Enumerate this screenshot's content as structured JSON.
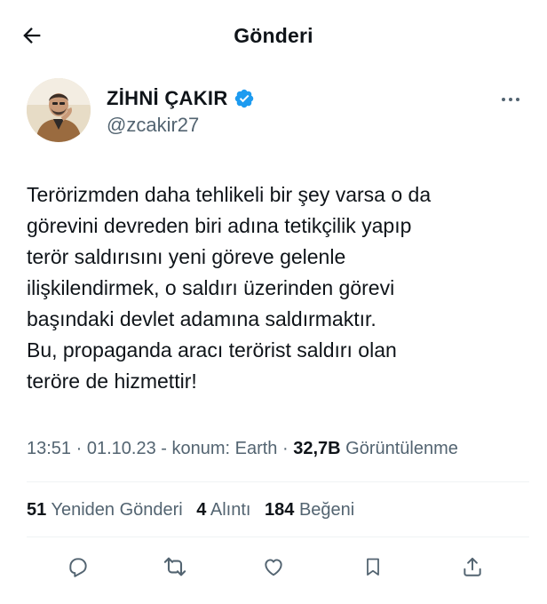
{
  "header": {
    "title": "Gönderi",
    "back_icon": "arrow-left-icon"
  },
  "author": {
    "display_name": "ZİHNİ ÇAKIR",
    "handle": "@zcakir27",
    "verified": true,
    "verified_color": "#1d9bf0"
  },
  "tweet": {
    "text": "Terörizmden daha tehlikeli bir şey varsa o da\ngörevini devreden biri adına tetikçilik yapıp\nterör saldırısını yeni göreve gelenle\nilişkilendirmek, o saldırı üzerinden görevi\nbaşındaki devlet adamına saldırmaktır.\nBu, propaganda aracı terörist saldırı olan\nteröre de hizmettir!"
  },
  "meta": {
    "time": "13:51",
    "date": "01.10.23",
    "location": "konum: Earth",
    "views_count": "32,7B",
    "views_label": "Görüntülenme"
  },
  "stats": {
    "reposts_count": "51",
    "reposts_label": "Yeniden Gönderi",
    "quotes_count": "4",
    "quotes_label": "Alıntı",
    "likes_count": "184",
    "likes_label": "Beğeni"
  },
  "actions": [
    "reply-icon",
    "repost-icon",
    "like-icon",
    "bookmark-icon",
    "share-icon"
  ],
  "colors": {
    "text": "#0f1419",
    "secondary": "#536471",
    "accent": "#1d9bf0",
    "divider": "#eff3f4"
  }
}
